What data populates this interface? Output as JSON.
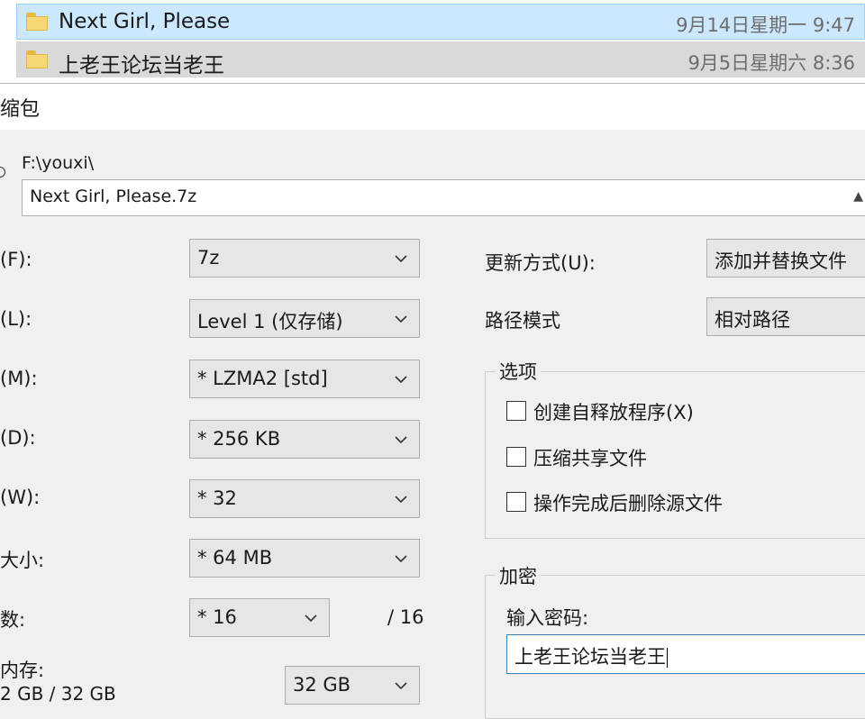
{
  "files": [
    {
      "name": "Next Girl, Please",
      "date": "9月14日星期一 9:47",
      "selected": true
    },
    {
      "name": "上老王论坛当老王",
      "date": "9月5日星期六 8:36",
      "selected": false
    }
  ],
  "dialog": {
    "title": "缩包",
    "path_label": "F:\\youxi\\",
    "archive_name": "Next Girl, Please.7z",
    "archive_arrow": "▲"
  },
  "left": {
    "format": {
      "label": "(F):",
      "value": "7z"
    },
    "level": {
      "label": "(L):",
      "value": "Level 1 (仅存储)"
    },
    "method": {
      "label": "(M):",
      "value": "*  LZMA2 [std]"
    },
    "dictionary": {
      "label": "(D):",
      "value": "*  256 KB"
    },
    "word": {
      "label": "(W):",
      "value": "*  32"
    },
    "solid": {
      "label": "大小:",
      "value": "*  64 MB"
    },
    "threads": {
      "label": "数:",
      "value": "*  16",
      "max": "/ 16"
    },
    "memory": {
      "label": "内存:",
      "usage": "2 GB / 32 GB",
      "value": "32 GB"
    }
  },
  "right": {
    "update_mode": {
      "label": "更新方式(U):",
      "value": "添加并替换文件"
    },
    "path_mode": {
      "label": "路径模式",
      "value": "相对路径"
    },
    "options": {
      "title": "选项",
      "items": [
        {
          "label": "创建自释放程序(X)",
          "checked": false
        },
        {
          "label": "压缩共享文件",
          "checked": false
        },
        {
          "label": "操作完成后删除源文件",
          "checked": false
        }
      ]
    },
    "encryption": {
      "title": "加密",
      "password_label": "输入密码:",
      "password_value": "上老王论坛当老王"
    }
  },
  "colors": {
    "selected_row": "#cce8ff",
    "hover_row": "#d9d9d9",
    "folder": "#f8d775",
    "focus_border": "#3c7fb1"
  }
}
